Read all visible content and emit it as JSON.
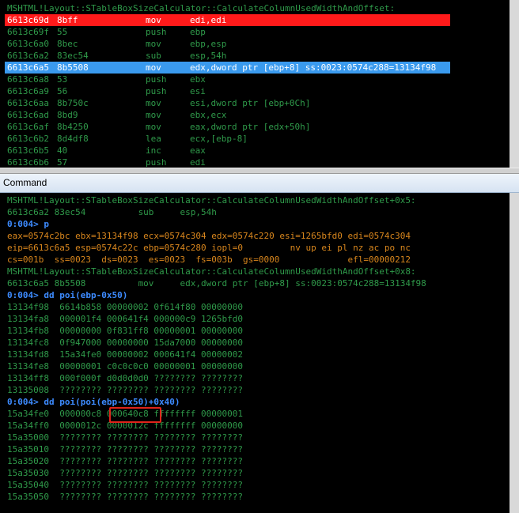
{
  "disasm": {
    "header": "MSHTML!Layout::STableBoxSizeCalculator::CalculateColumnUsedWidthAndOffset:",
    "rows": [
      {
        "addr": "6613c69d",
        "bytes": "8bff",
        "op": "mov",
        "args": "edi,edi"
      },
      {
        "addr": "6613c69f",
        "bytes": "55",
        "op": "push",
        "args": "ebp"
      },
      {
        "addr": "6613c6a0",
        "bytes": "8bec",
        "op": "mov",
        "args": "ebp,esp"
      },
      {
        "addr": "6613c6a2",
        "bytes": "83ec54",
        "op": "sub",
        "args": "esp,54h"
      },
      {
        "addr": "6613c6a5",
        "bytes": "8b5508",
        "op": "mov",
        "args": "edx,dword ptr [ebp+8] ss:0023:0574c288=13134f98"
      },
      {
        "addr": "6613c6a8",
        "bytes": "53",
        "op": "push",
        "args": "ebx"
      },
      {
        "addr": "6613c6a9",
        "bytes": "56",
        "op": "push",
        "args": "esi"
      },
      {
        "addr": "6613c6aa",
        "bytes": "8b750c",
        "op": "mov",
        "args": "esi,dword ptr [ebp+0Ch]"
      },
      {
        "addr": "6613c6ad",
        "bytes": "8bd9",
        "op": "mov",
        "args": "ebx,ecx"
      },
      {
        "addr": "6613c6af",
        "bytes": "8b4250",
        "op": "mov",
        "args": "eax,dword ptr [edx+50h]"
      },
      {
        "addr": "6613c6b2",
        "bytes": "8d4df8",
        "op": "lea",
        "args": "ecx,[ebp-8]"
      },
      {
        "addr": "6613c6b5",
        "bytes": "40",
        "op": "inc",
        "args": "eax"
      },
      {
        "addr": "6613c6b6",
        "bytes": "57",
        "op": "push",
        "args": "edi"
      }
    ],
    "breakpoint_color": "#ff1a1a",
    "current_color": "#3a9aee"
  },
  "command": {
    "title": "Command",
    "lines": [
      {
        "t": "MSHTML!Layout::STableBoxSizeCalculator::CalculateColumnUsedWidthAndOffset+0x5:",
        "c": "green"
      },
      {
        "t": "6613c6a2 83ec54          sub     esp,54h",
        "c": "green"
      },
      {
        "t": "0:004> p",
        "c": "blue"
      },
      {
        "t": "eax=0574c2bc ebx=13134f98 ecx=0574c304 edx=0574c220 esi=1265bfd0 edi=0574c304",
        "c": "orange"
      },
      {
        "t": "eip=6613c6a5 esp=0574c22c ebp=0574c280 iopl=0         nv up ei pl nz ac po nc",
        "c": "orange"
      },
      {
        "t": "cs=001b  ss=0023  ds=0023  es=0023  fs=003b  gs=0000             efl=00000212",
        "c": "orange"
      },
      {
        "t": "MSHTML!Layout::STableBoxSizeCalculator::CalculateColumnUsedWidthAndOffset+0x8:",
        "c": "green"
      },
      {
        "t": "6613c6a5 8b5508          mov     edx,dword ptr [ebp+8] ss:0023:0574c288=13134f98",
        "c": "green"
      },
      {
        "t": "0:004> dd poi(ebp-0x50)",
        "c": "blue"
      },
      {
        "t": "13134f98  6614b858 00000002 0f614f80 00000000",
        "c": "green"
      },
      {
        "t": "13134fa8  000001f4 000641f4 000000c9 1265bfd0",
        "c": "green"
      },
      {
        "t": "13134fb8  00000000 0f831ff8 00000001 00000000",
        "c": "green"
      },
      {
        "t": "13134fc8  0f947000 00000000 15da7000 00000000",
        "c": "green"
      },
      {
        "t": "13134fd8  15a34fe0 00000002 000641f4 00000002",
        "c": "green"
      },
      {
        "t": "13134fe8  00000001 c0c0c0c0 00000001 00000000",
        "c": "green"
      },
      {
        "t": "13134ff8  000f000f d0d0d0d0 ???????? ????????",
        "c": "green"
      },
      {
        "t": "13135008  ???????? ???????? ???????? ????????",
        "c": "green"
      },
      {
        "t": "0:004> dd poi(poi(ebp-0x50)+0x40)",
        "c": "blue"
      },
      {
        "t": "15a34fe0  000000c8 000640c8 ffffffff 00000001",
        "c": "green"
      },
      {
        "t": "15a34ff0  0000012c 0000012c ffffffff 00000000",
        "c": "green"
      },
      {
        "t": "15a35000  ???????? ???????? ???????? ????????",
        "c": "green"
      },
      {
        "t": "15a35010  ???????? ???????? ???????? ????????",
        "c": "green"
      },
      {
        "t": "15a35020  ???????? ???????? ???????? ????????",
        "c": "green"
      },
      {
        "t": "15a35030  ???????? ???????? ???????? ????????",
        "c": "green"
      },
      {
        "t": "15a35040  ???????? ???????? ???????? ????????",
        "c": "green"
      },
      {
        "t": "15a35050  ???????? ???????? ???????? ????????",
        "c": "green"
      }
    ]
  }
}
